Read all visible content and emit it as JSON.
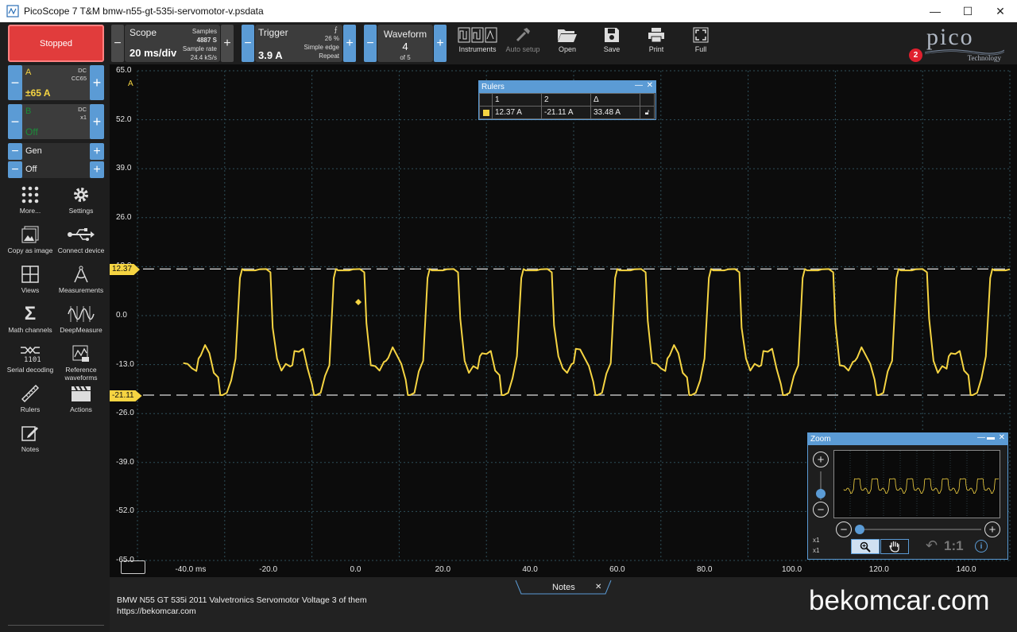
{
  "window": {
    "title": "PicoScope 7 T&M bmw-n55-gt-535i-servomotor-v.psdata"
  },
  "run": {
    "label": "Stopped"
  },
  "scope": {
    "title": "Scope",
    "timebase": "20 ms/div",
    "samples_label": "Samples",
    "samples": "4887 S",
    "rate_label": "Sample rate",
    "rate": "24.4 kS/s"
  },
  "trigger": {
    "title": "Trigger",
    "value": "3.9 A",
    "percent": "26 %",
    "mode": "Simple edge",
    "repeat": "Repeat"
  },
  "waveform": {
    "title": "Waveform",
    "current": "4",
    "of": "of 5"
  },
  "tools": [
    {
      "label": "Instruments",
      "icon": "instruments-icon"
    },
    {
      "label": "Auto setup",
      "icon": "auto-setup-icon"
    },
    {
      "label": "Open",
      "icon": "folder-open-icon"
    },
    {
      "label": "Save",
      "icon": "save-icon"
    },
    {
      "label": "Print",
      "icon": "print-icon"
    },
    {
      "label": "Full",
      "icon": "fullscreen-icon"
    }
  ],
  "brand": {
    "logo": "pico",
    "sub": "Technology",
    "badge": "2"
  },
  "channels": {
    "a": {
      "name": "A",
      "coupling": "DC",
      "probe": "CC65",
      "range": "±65 A",
      "color": "#f5d442"
    },
    "b": {
      "name": "B",
      "coupling": "DC",
      "probe": "x1",
      "range": "Off",
      "color": "#1c8c3a"
    },
    "gen": {
      "name": "Gen",
      "state": "Off"
    }
  },
  "sidebar": [
    {
      "label": "More...",
      "icon": "more-grid-icon"
    },
    {
      "label": "Settings",
      "icon": "gear-icon"
    },
    {
      "label": "Copy as image",
      "icon": "image-icon"
    },
    {
      "label": "Connect device",
      "icon": "usb-icon"
    },
    {
      "label": "Views",
      "icon": "views-icon"
    },
    {
      "label": "Measurements",
      "icon": "measurements-icon"
    },
    {
      "label": "Math channels",
      "icon": "sigma-icon"
    },
    {
      "label": "DeepMeasure",
      "icon": "deepmeasure-icon"
    },
    {
      "label": "Serial decoding",
      "icon": "serial-decoding-icon"
    },
    {
      "label": "Reference waveforms",
      "icon": "reference-waveforms-icon"
    },
    {
      "label": "Rulers",
      "icon": "ruler-icon"
    },
    {
      "label": "Actions",
      "icon": "clapperboard-icon"
    },
    {
      "label": "Notes",
      "icon": "notes-icon"
    }
  ],
  "plot": {
    "unit": "A",
    "yticks": [
      "65.0",
      "52.0",
      "39.0",
      "26.0",
      "13.0",
      "0.0",
      "-13.0",
      "-26.0",
      "-39.0",
      "-52.0",
      "-65.0"
    ],
    "xticks": [
      "-40.0 ms",
      "-20.0",
      "0.0",
      "20.0",
      "40.0",
      "60.0",
      "80.0",
      "100.0",
      "120.0",
      "140.0"
    ],
    "ruler_top": "12.37",
    "ruler_bottom": "-21.11"
  },
  "rulers": {
    "title": "Rulers",
    "col1": "1",
    "col2": "2",
    "col3": "Δ",
    "v1": "12.37 A",
    "v2": "-21.11 A",
    "delta": "33.48 A"
  },
  "zoom": {
    "title": "Zoom",
    "ratio": "1:1",
    "x1": "x1",
    "y1": "x1"
  },
  "notes": {
    "tab": "Notes",
    "line1": "BMW N55 GT 535i 2011 Valvetronics Servomotor Voltage 3 of them",
    "line2": "https://bekomcar.com"
  },
  "watermark": "bekomcar.com",
  "chart_data": {
    "type": "line",
    "xlim": [
      -50,
      150
    ],
    "ylim": [
      -65,
      65
    ],
    "period": 21.5,
    "t0": -47.5,
    "series": [
      {
        "color": "#f5d442",
        "x": [
          0,
          0.5,
          3.0,
          4.0,
          5.5,
          6.5,
          7.0,
          8.0,
          9.0,
          10.0,
          11.0,
          11.5,
          12.0,
          13.0,
          14.0,
          15.0,
          16.0,
          16.5,
          17.0,
          18.0,
          19.0,
          20.0,
          21.0,
          21.5
        ],
        "y": [
          12.37,
          12.0,
          12.0,
          12.3,
          12.37,
          11.5,
          -2.0,
          -12.0,
          -14.0,
          -14.0,
          -13.5,
          -12.0,
          -10.0,
          -9.0,
          -10.0,
          -14.0,
          -17.0,
          -21.11,
          -21.11,
          -20.5,
          -16.0,
          -12.0,
          10.0,
          12.37
        ]
      }
    ]
  }
}
